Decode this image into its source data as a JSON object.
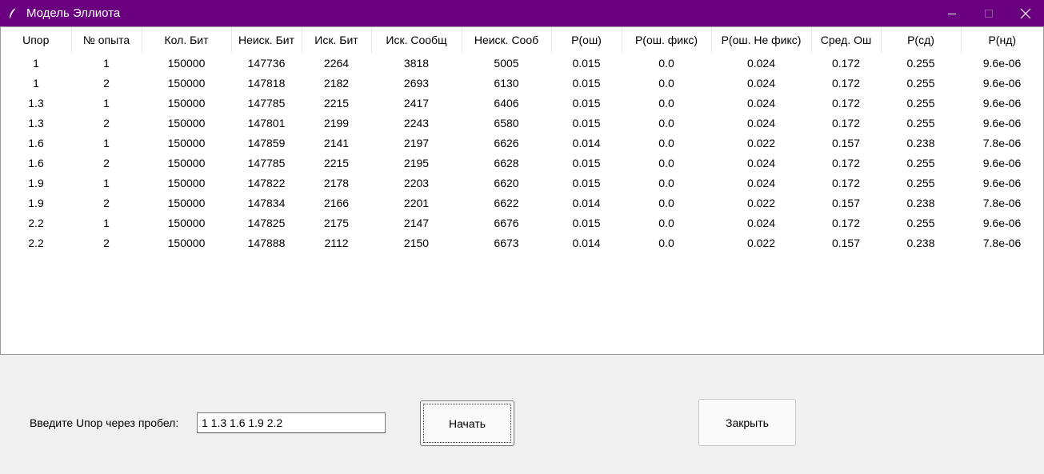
{
  "window": {
    "title": "Модель Эллиота",
    "icon": "feather-icon",
    "title_color": "#6a0080"
  },
  "table": {
    "columns": [
      "Uпор",
      "№ опыта",
      "Кол. Бит",
      "Неиск. Бит",
      "Иск. Бит",
      "Иск. Сообщ",
      "Неиск. Сооб",
      "P(ош)",
      "P(ош. фикс)",
      "P(ош. Не фикс)",
      "Сред. Ош",
      "P(сд)",
      "P(нд)"
    ],
    "rows": [
      [
        "1",
        "1",
        "150000",
        "147736",
        "2264",
        "3818",
        "5005",
        "0.015",
        "0.0",
        "0.024",
        "0.172",
        "0.255",
        "9.6e-06"
      ],
      [
        "1",
        "2",
        "150000",
        "147818",
        "2182",
        "2693",
        "6130",
        "0.015",
        "0.0",
        "0.024",
        "0.172",
        "0.255",
        "9.6e-06"
      ],
      [
        "1.3",
        "1",
        "150000",
        "147785",
        "2215",
        "2417",
        "6406",
        "0.015",
        "0.0",
        "0.024",
        "0.172",
        "0.255",
        "9.6e-06"
      ],
      [
        "1.3",
        "2",
        "150000",
        "147801",
        "2199",
        "2243",
        "6580",
        "0.015",
        "0.0",
        "0.024",
        "0.172",
        "0.255",
        "9.6e-06"
      ],
      [
        "1.6",
        "1",
        "150000",
        "147859",
        "2141",
        "2197",
        "6626",
        "0.014",
        "0.0",
        "0.022",
        "0.157",
        "0.238",
        "7.8e-06"
      ],
      [
        "1.6",
        "2",
        "150000",
        "147785",
        "2215",
        "2195",
        "6628",
        "0.015",
        "0.0",
        "0.024",
        "0.172",
        "0.255",
        "9.6e-06"
      ],
      [
        "1.9",
        "1",
        "150000",
        "147822",
        "2178",
        "2203",
        "6620",
        "0.015",
        "0.0",
        "0.024",
        "0.172",
        "0.255",
        "9.6e-06"
      ],
      [
        "1.9",
        "2",
        "150000",
        "147834",
        "2166",
        "2201",
        "6622",
        "0.014",
        "0.0",
        "0.022",
        "0.157",
        "0.238",
        "7.8e-06"
      ],
      [
        "2.2",
        "1",
        "150000",
        "147825",
        "2175",
        "2147",
        "6676",
        "0.015",
        "0.0",
        "0.024",
        "0.172",
        "0.255",
        "9.6e-06"
      ],
      [
        "2.2",
        "2",
        "150000",
        "147888",
        "2112",
        "2150",
        "6673",
        "0.014",
        "0.0",
        "0.022",
        "0.157",
        "0.238",
        "7.8e-06"
      ]
    ]
  },
  "controls": {
    "input_label": "Введите Uпор через пробел:",
    "input_value": "1 1.3 1.6 1.9 2.2",
    "start_label": "Начать",
    "close_label": "Закрыть"
  }
}
